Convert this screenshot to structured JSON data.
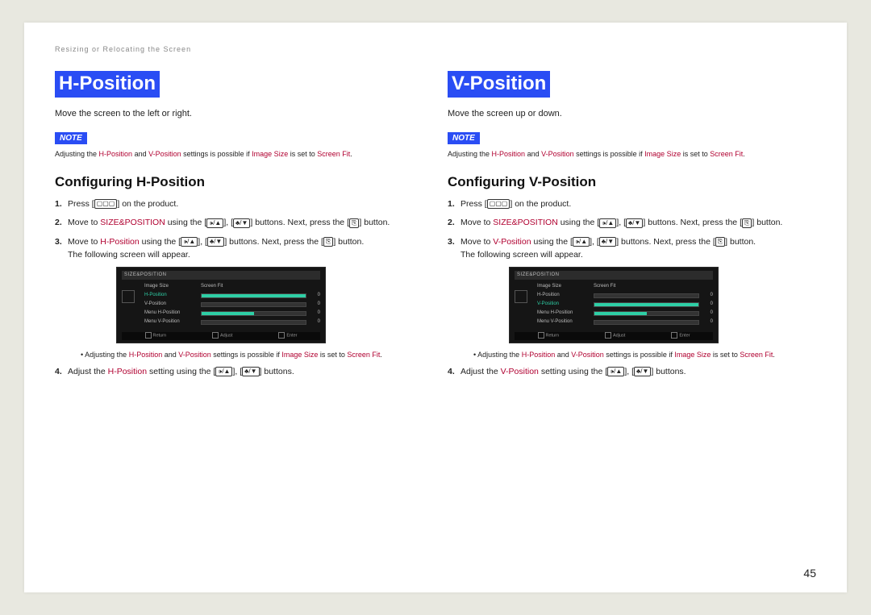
{
  "breadcrumb": "Resizing or Relocating the Screen",
  "page_number": "45",
  "note_label": "NOTE",
  "icons": {
    "menu": "▢▢▢",
    "vol_up": "🕩/▲",
    "vol_dn": "♣/▼",
    "enter": "⎘"
  },
  "left": {
    "title": "H-Position",
    "desc": "Move the screen to the left or right.",
    "note": {
      "pre": "Adjusting the ",
      "k1": "H-Position",
      "mid1": " and ",
      "k2": "V-Position",
      "mid2": " settings is possible if ",
      "k3": "Image Size",
      "mid3": " is set to ",
      "k4": "Screen Fit",
      "post": "."
    },
    "h2": "Configuring H-Position",
    "s1a": "Press [",
    "s1b": "] on the product.",
    "s2a": "Move to ",
    "s2k": "SIZE&POSITION",
    "s2b": " using the [",
    "s2c": "], [",
    "s2d": "] buttons. Next, press the [",
    "s2e": "] button.",
    "s3a": "Move to ",
    "s3k": "H-Position",
    "s3b": " using the [",
    "s3c": "], [",
    "s3d": "] buttons. Next, press the [",
    "s3e": "] button.",
    "s3f": "The following screen will appear.",
    "bnote": {
      "pre": "Adjusting the ",
      "k1": "H-Position",
      "mid1": " and ",
      "k2": "V-Position",
      "mid2": " settings is possible if ",
      "k3": "Image Size",
      "mid3": " is set to ",
      "k4": "Screen Fit",
      "post": "."
    },
    "s4a": "Adjust the ",
    "s4k": "H-Position",
    "s4b": " setting using the [",
    "s4c": "], [",
    "s4d": "] buttons.",
    "osd": {
      "title": "SIZE&POSITION",
      "r1_lbl": "Image Size",
      "r1_val": "Screen Fit",
      "r2_lbl": "H-Position",
      "r2_num": "0",
      "r3_lbl": "V-Position",
      "r3_num": "0",
      "r4_lbl": "Menu H-Position",
      "r4_num": "0",
      "r5_lbl": "Menu V-Position",
      "r5_num": "0",
      "f1": "Return",
      "f2": "Adjust",
      "f3": "Enter"
    }
  },
  "right": {
    "title": "V-Position",
    "desc": "Move the screen up or down.",
    "note": {
      "pre": "Adjusting the ",
      "k1": "H-Position",
      "mid1": " and ",
      "k2": "V-Position",
      "mid2": " settings is possible if ",
      "k3": "Image Size",
      "mid3": " is set to ",
      "k4": "Screen Fit",
      "post": "."
    },
    "h2": "Configuring V-Position",
    "s1a": "Press [",
    "s1b": "] on the product.",
    "s2a": "Move to ",
    "s2k": "SIZE&POSITION",
    "s2b": " using the [",
    "s2c": "], [",
    "s2d": "] buttons. Next, press the [",
    "s2e": "] button.",
    "s3a": "Move to ",
    "s3k": "V-Position",
    "s3b": " using the [",
    "s3c": "], [",
    "s3d": "] buttons. Next, press the [",
    "s3e": "] button.",
    "s3f": "The following screen will appear.",
    "bnote": {
      "pre": "Adjusting the ",
      "k1": "H-Position",
      "mid1": " and ",
      "k2": "V-Position",
      "mid2": " settings is possible if ",
      "k3": "Image Size",
      "mid3": " is set to ",
      "k4": "Screen Fit",
      "post": "."
    },
    "s4a": "Adjust the ",
    "s4k": "V-Position",
    "s4b": " setting using the [",
    "s4c": "], [",
    "s4d": "] buttons.",
    "osd": {
      "title": "SIZE&POSITION",
      "r1_lbl": "Image Size",
      "r1_val": "Screen Fit",
      "r2_lbl": "H-Position",
      "r2_num": "0",
      "r3_lbl": "V-Position",
      "r3_num": "0",
      "r4_lbl": "Menu H-Position",
      "r4_num": "0",
      "r5_lbl": "Menu V-Position",
      "r5_num": "0",
      "f1": "Return",
      "f2": "Adjust",
      "f3": "Enter"
    }
  }
}
